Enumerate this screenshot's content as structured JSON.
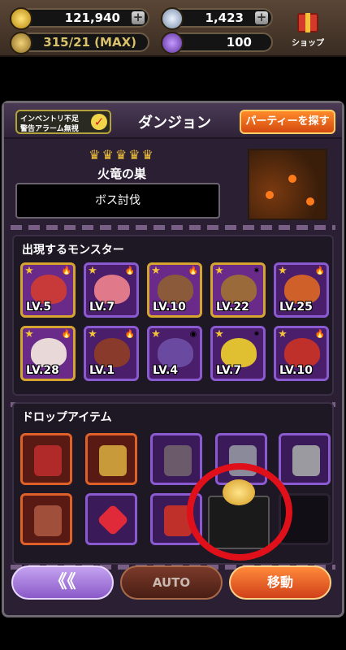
{
  "resources": {
    "gold": "121,940",
    "gems": "1,423",
    "stamina": "315/21 (MAX)",
    "crystal": "100",
    "shop_label": "ショップ"
  },
  "panel": {
    "alarm_line1": "インベントリ不足",
    "alarm_line2": "警告アラーム無視",
    "title": "ダンジョン",
    "party_button": "パーティーを探す"
  },
  "dungeon": {
    "difficulty_crowns": "♛♛♛♛♛",
    "name": "火竜の巣",
    "objective": "ボス討伐"
  },
  "monsters_section": {
    "title": "出現するモンスター",
    "monsters": [
      {
        "level": "LV.5",
        "color": "#c83a3a",
        "element": "🔥"
      },
      {
        "level": "LV.7",
        "color": "#e07a8a",
        "element": "🔥"
      },
      {
        "level": "LV.10",
        "color": "#8a5a3a",
        "element": "🔥"
      },
      {
        "level": "LV.22",
        "color": "#9a6a3a",
        "element": "✷"
      },
      {
        "level": "LV.25",
        "color": "#d0602a",
        "element": "🔥"
      },
      {
        "level": "LV.28",
        "color": "#e8d8d8",
        "element": "🔥"
      },
      {
        "level": "LV.1",
        "color": "#8a3a2a",
        "element": "🔥"
      },
      {
        "level": "LV.4",
        "color": "#6a4aa0",
        "element": "◉"
      },
      {
        "level": "LV.7",
        "color": "#e0c030",
        "element": "✷"
      },
      {
        "level": "LV.10",
        "color": "#c0302a",
        "element": "🔥"
      }
    ]
  },
  "drops_section": {
    "title": "ドロップアイテム"
  },
  "buttons": {
    "back": "《《",
    "auto": "AUTO",
    "move": "移動"
  }
}
